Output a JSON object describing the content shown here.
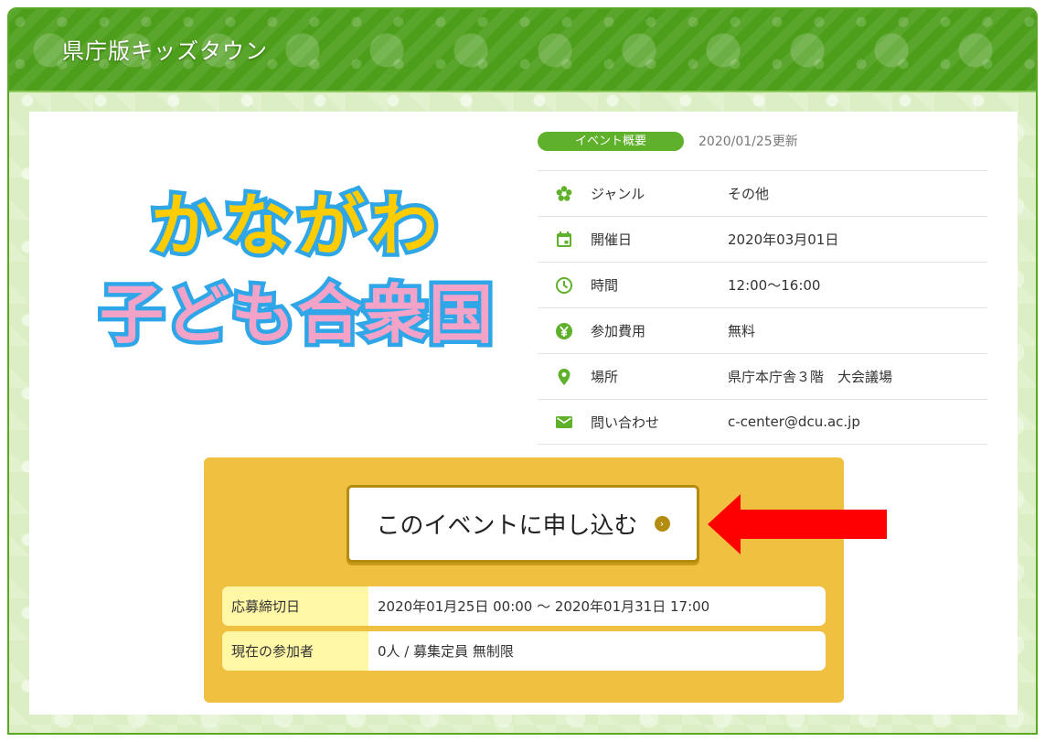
{
  "header": {
    "title": "県庁版キッズタウン"
  },
  "event": {
    "logo_line1": "かながわ",
    "logo_line2": "子ども合衆国",
    "tag": "イベント概要",
    "updated": "2020/01/25更新",
    "rows": [
      {
        "icon": "flower-icon",
        "label": "ジャンル",
        "value": "その他"
      },
      {
        "icon": "calendar-icon",
        "label": "開催日",
        "value": "2020年03月01日"
      },
      {
        "icon": "clock-icon",
        "label": "時間",
        "value": "12:00〜16:00"
      },
      {
        "icon": "yen-icon",
        "label": "参加費用",
        "value": "無料"
      },
      {
        "icon": "location-pin-icon",
        "label": "場所",
        "value": "県庁本庁舎３階　大会議場"
      },
      {
        "icon": "mail-icon",
        "label": "問い合わせ",
        "value": "c-center@dcu.ac.jp"
      }
    ]
  },
  "apply": {
    "button_label": "このイベントに申し込む",
    "deadline_label": "応募締切日",
    "deadline_value": "2020年01月25日 00:00 〜  2020年01月31日 17:00",
    "participants_label": "現在の参加者",
    "participants_value": "0人 /  募集定員  無制限"
  },
  "colors": {
    "brand_green": "#4c9e1b",
    "tag_green": "#5fb12c",
    "apply_box": "#f0c040",
    "arrow_red": "#ff0000"
  }
}
